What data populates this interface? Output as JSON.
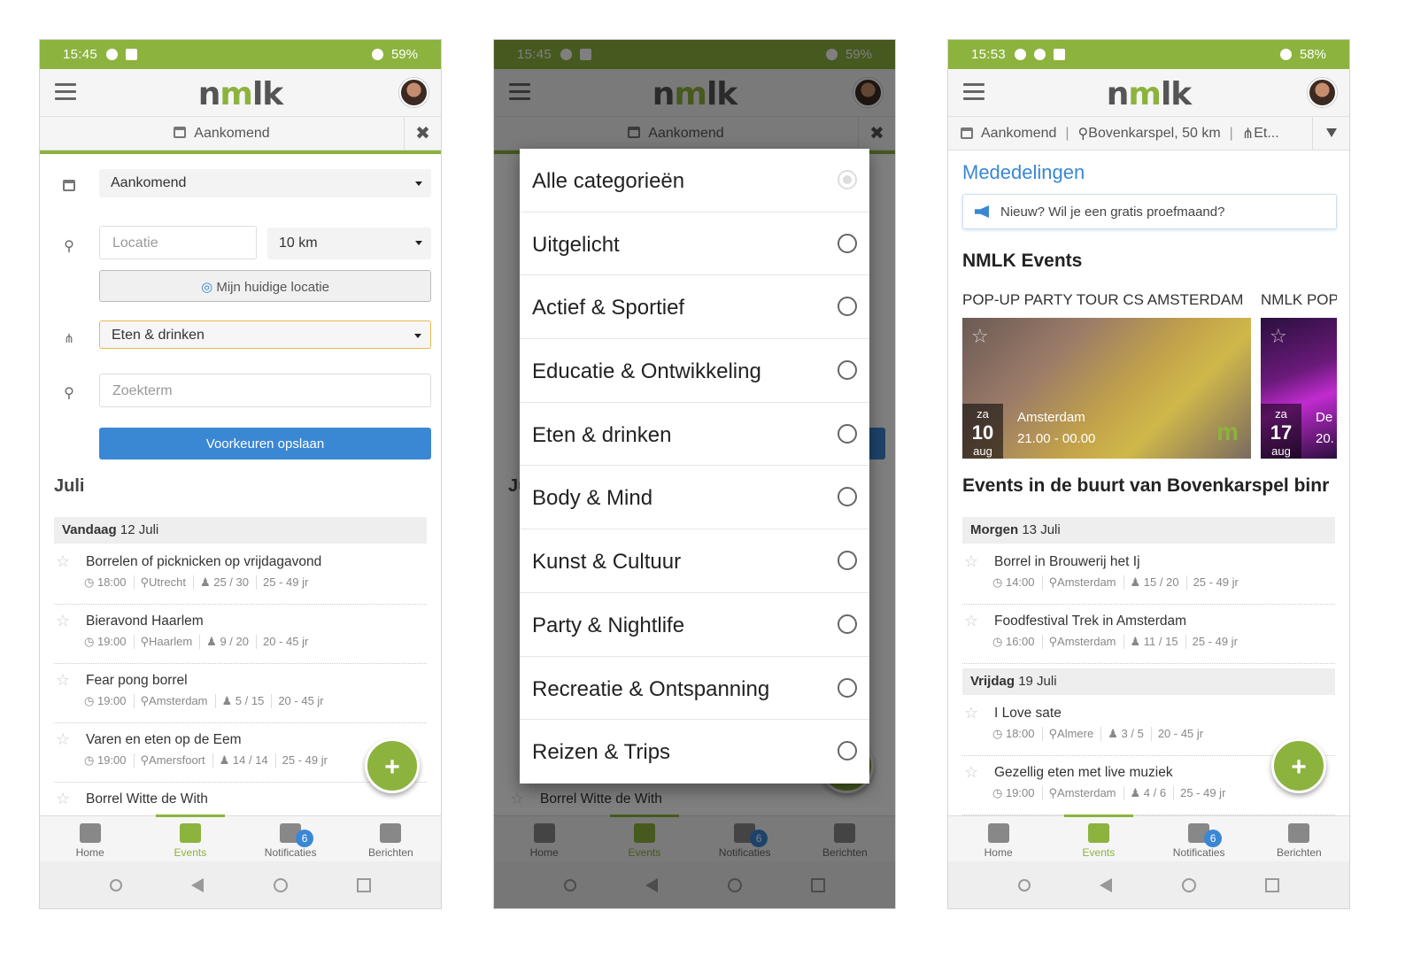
{
  "colors": {
    "brand_green": "#8cb33e",
    "primary_blue": "#3a87d4"
  },
  "logo": {
    "left": "n",
    "m": "m",
    "right": "lk"
  },
  "nav": {
    "home": "Home",
    "events": "Events",
    "notifications": "Notificaties",
    "notifications_badge": "6",
    "messages": "Berichten"
  },
  "screen1": {
    "status": {
      "time": "15:45",
      "battery": "59%"
    },
    "filterbar": {
      "label": "Aankomend"
    },
    "filter": {
      "period": "Aankomend",
      "location_placeholder": "Locatie",
      "distance": "10 km",
      "my_location": "Mijn huidige locatie",
      "category": "Eten & drinken",
      "search_placeholder": "Zoekterm",
      "save": "Voorkeuren opslaan"
    },
    "month": "Juli",
    "day": {
      "label": "Vandaag",
      "date": "12 Juli"
    },
    "events": [
      {
        "title": "Borrelen of picknicken op vrijdagavond",
        "time": "18:00",
        "place": "Utrecht",
        "spots": "25 / 30",
        "age": "25 - 49 jr"
      },
      {
        "title": "Bieravond Haarlem",
        "time": "19:00",
        "place": "Haarlem",
        "spots": "9 / 20",
        "age": "20 - 45 jr"
      },
      {
        "title": "Fear pong borrel",
        "time": "19:00",
        "place": "Amsterdam",
        "spots": "5 / 15",
        "age": "20 - 45 jr"
      },
      {
        "title": "Varen en eten op de Eem",
        "time": "19:00",
        "place": "Amersfoort",
        "spots": "14 / 14",
        "age": "25 - 49 jr"
      },
      {
        "title": "Borrel Witte de With"
      }
    ]
  },
  "screen2": {
    "status": {
      "time": "15:45",
      "battery": "59%"
    },
    "filterbar": {
      "label": "Aankomend"
    },
    "month_partial": "Ju",
    "behind_event": "Borrel Witte de With",
    "options": [
      "Alle categorieën",
      "Uitgelicht",
      "Actief & Sportief",
      "Educatie & Ontwikkeling",
      "Eten & drinken",
      "Body & Mind",
      "Kunst & Cultuur",
      "Party & Nightlife",
      "Recreatie & Ontspanning",
      "Reizen & Trips"
    ]
  },
  "screen3": {
    "status": {
      "time": "15:53",
      "battery": "58%"
    },
    "filterbar": {
      "period": "Aankomend",
      "location": "Bovenkarspel, 50 km",
      "category": "Et..."
    },
    "announcements_title": "Mededelingen",
    "announcement": "Nieuw? Wil je een gratis proefmaand?",
    "events_title": "NMLK Events",
    "cards": [
      {
        "title": "POP-UP PARTY TOUR CS AMSTERDAM",
        "weekday": "za",
        "day": "10",
        "month": "aug",
        "place": "Amsterdam",
        "time": "21.00 - 00.00"
      },
      {
        "title": "NMLK POP",
        "weekday": "za",
        "day": "17",
        "month": "aug",
        "place": "De",
        "time": "20."
      }
    ],
    "nearby_title": "Events in de buurt van Bovenkarspel binr",
    "days": [
      {
        "label": "Morgen",
        "date": "13 Juli"
      },
      {
        "label": "Vrijdag",
        "date": "19 Juli"
      }
    ],
    "events": [
      {
        "title": "Borrel in Brouwerij het Ij",
        "time": "14:00",
        "place": "Amsterdam",
        "spots": "15 / 20",
        "age": "25 - 49 jr"
      },
      {
        "title": "Foodfestival Trek in Amsterdam",
        "time": "16:00",
        "place": "Amsterdam",
        "spots": "11 / 15",
        "age": "25 - 49 jr"
      },
      {
        "title": "I Love sate",
        "time": "18:00",
        "place": "Almere",
        "spots": "3 / 5",
        "age": "20 - 45 jr"
      },
      {
        "title": "Gezellig eten met live muziek",
        "time": "19:00",
        "place": "Amsterdam",
        "spots": "4 / 6",
        "age": "25 - 49 jr"
      }
    ]
  }
}
